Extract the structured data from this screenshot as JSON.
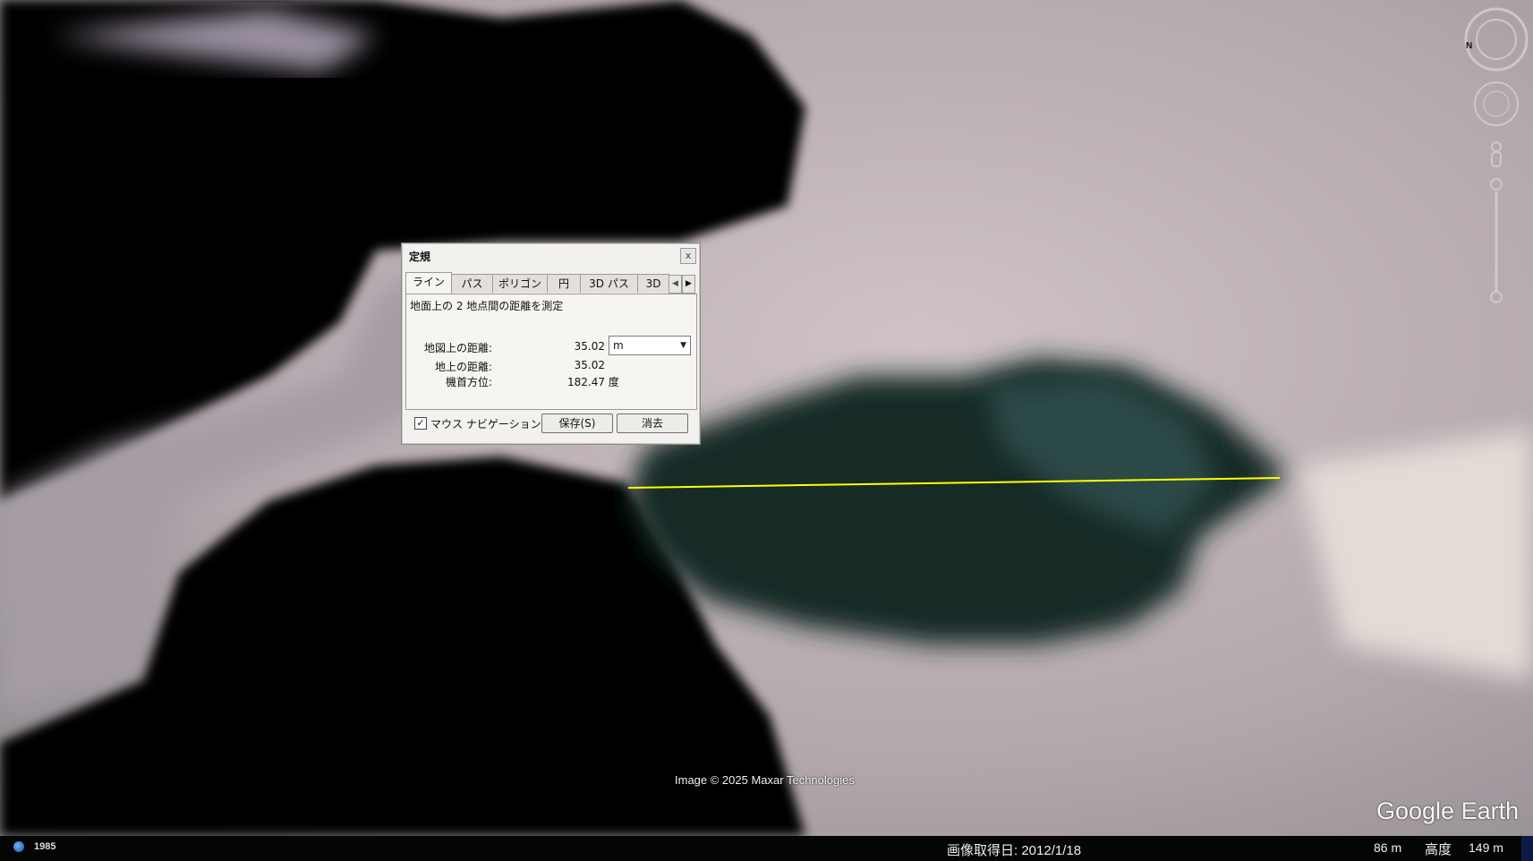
{
  "window": {
    "title": "Google Earth"
  },
  "ruler": {
    "title": "定規",
    "close_label": "x",
    "tabs": [
      {
        "label": "ライン",
        "active": true
      },
      {
        "label": "パス",
        "active": false
      },
      {
        "label": "ポリゴン",
        "active": false
      },
      {
        "label": "円",
        "active": false
      },
      {
        "label": "3D パス",
        "active": false
      },
      {
        "label": "3D",
        "active": false
      }
    ],
    "description": "地面上の 2 地点間の距離を測定",
    "map_distance_label": "地図上の距離:",
    "map_distance_value": "35.02",
    "unit_selected": "m",
    "ground_distance_label": "地上の距離:",
    "ground_distance_value": "35.02",
    "heading_label": "機首方位:",
    "heading_value": "182.47 度",
    "mouse_nav_label": "マウス ナビゲーション",
    "mouse_nav_checked": true,
    "save_button": "保存(S)",
    "clear_button": "消去"
  },
  "map": {
    "credit": "Image © 2025 Maxar Technologies",
    "brand": "Google Earth",
    "measure_line_color": "#ffff00",
    "compass_north_label": "N"
  },
  "status": {
    "year": "1985",
    "acquisition_date": "画像取得日: 2012/1/18",
    "elevation": "86 m",
    "altitude_label": "高度",
    "altitude": "149 m"
  }
}
